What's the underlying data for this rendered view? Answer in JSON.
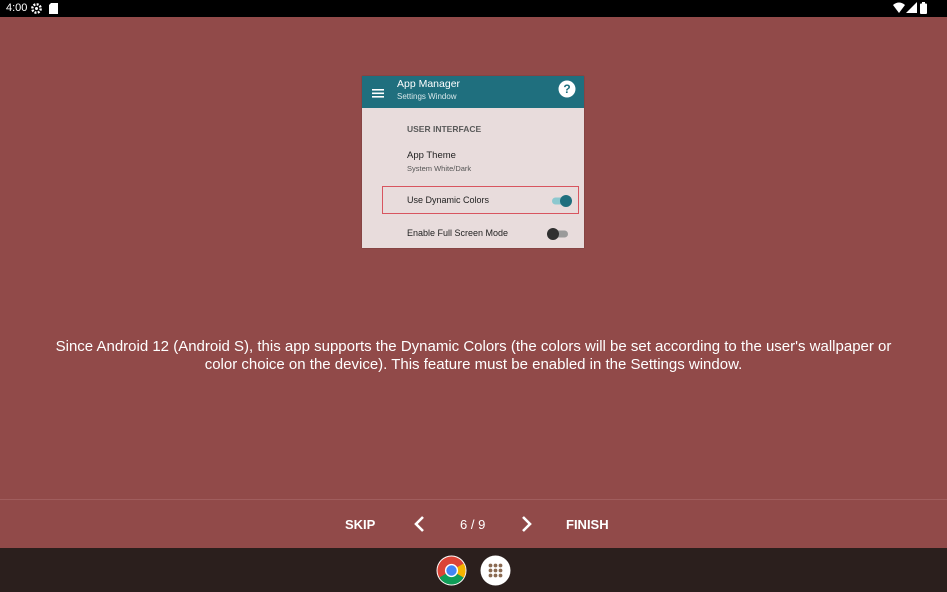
{
  "status_bar": {
    "time": "4:00",
    "icons": [
      "settings-icon",
      "sim-card-icon",
      "wifi-icon",
      "cellular-icon",
      "battery-icon"
    ]
  },
  "preview": {
    "app_title": "App Manager",
    "app_subtitle": "Settings Window",
    "help_glyph": "?",
    "section_header": "USER INTERFACE",
    "theme_title": "App Theme",
    "theme_subtitle": "System White/Dark",
    "dynamic_colors_label": "Use Dynamic Colors",
    "dynamic_colors_on": true,
    "full_screen_label": "Enable Full Screen Mode",
    "full_screen_on": false,
    "toolbar_color": "#1f6f7e",
    "highlight_color": "#d8555f"
  },
  "description": "Since Android 12 (Android S), this app supports the Dynamic Colors (the colors will be set according to the user's wallpaper or color choice on the device). This feature must be enabled in the Settings window.",
  "nav": {
    "skip_label": "SKIP",
    "page_indicator": "6 / 9",
    "finish_label": "FINISH"
  },
  "taskbar": {
    "icons": [
      "chrome-icon",
      "app-drawer-icon"
    ]
  },
  "colors": {
    "background": "#914a49",
    "taskbar": "#2b1f1d",
    "text": "#ffffff"
  }
}
